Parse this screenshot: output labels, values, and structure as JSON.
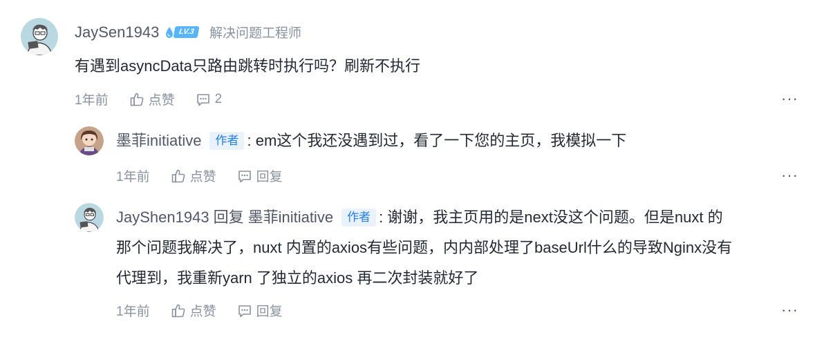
{
  "comment": {
    "username": "JaySen1943",
    "level_badge": "LV.3",
    "job_title": "解决问题工程师",
    "content": "有遇到asyncData只路由跳转时执行吗？刷新不执行",
    "time": "1年前",
    "like_label": "点赞",
    "reply_count": "2",
    "more": "···"
  },
  "replies": [
    {
      "username": "墨菲initiative",
      "author_tag": "作者",
      "content": ": em这个我还没遇到过，看了一下您的主页，我模拟一下",
      "time": "1年前",
      "like_label": "点赞",
      "reply_label": "回复",
      "more": "···"
    },
    {
      "username": "JayShen1943",
      "reply_word": "回复",
      "reply_to": "墨菲initiative",
      "author_tag": "作者",
      "content_line1": ": 谢谢，我主页用的是next没这个问题。但是nuxt 的",
      "content_line2": "那个问题我解决了，nuxt 内置的axios有些问题，内内部处理了baseUrl什么的导致Nginx没有",
      "content_line3": "代理到，我重新yarn 了独立的axios 再二次封装就好了",
      "time": "1年前",
      "like_label": "点赞",
      "reply_label": "回复",
      "more": "···"
    }
  ]
}
